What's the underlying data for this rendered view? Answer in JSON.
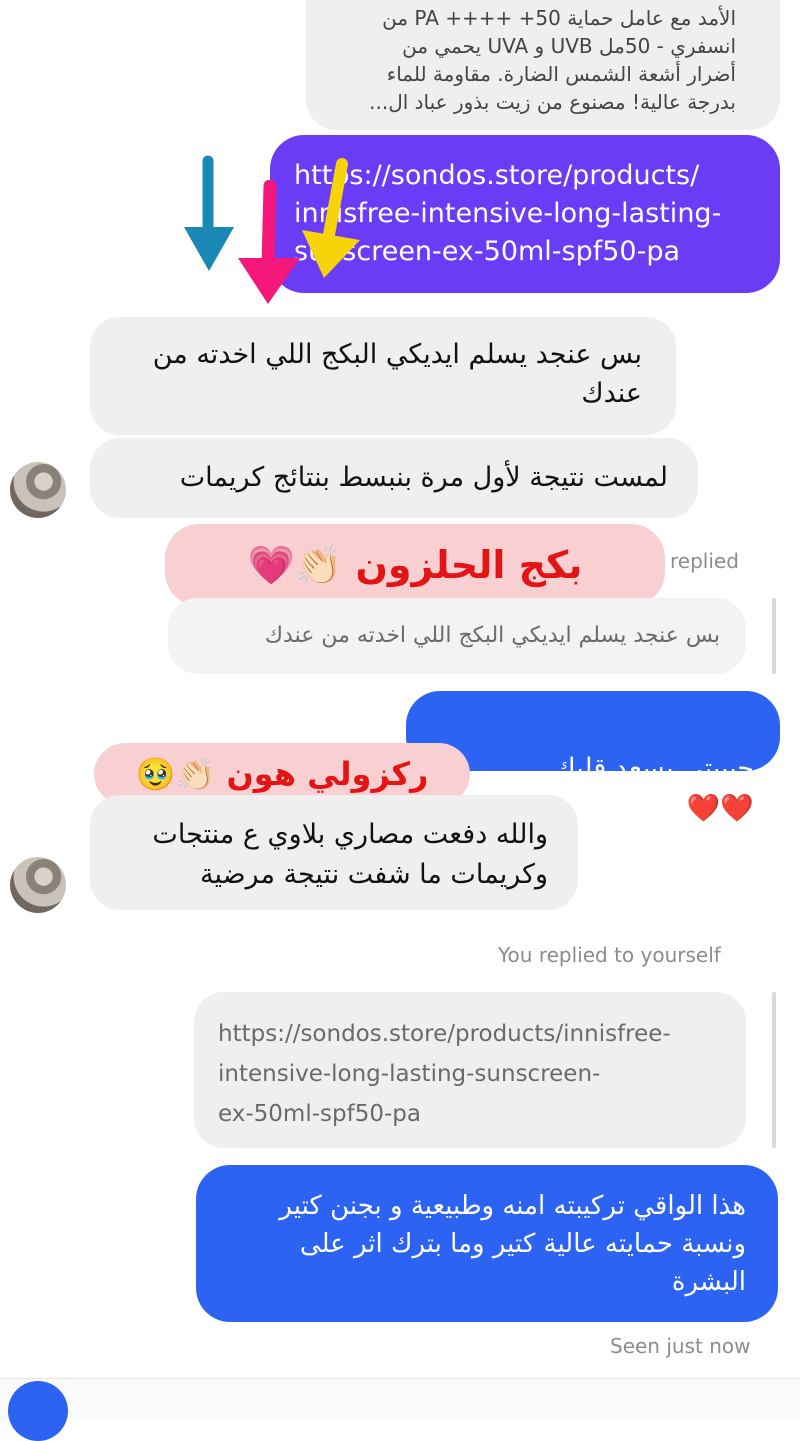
{
  "messages": {
    "top_incoming_text": "الأمد مع عامل حماية 50+ ++++ PA من\nانسفري - 50مل UVB و UVA يحمي من\nأضرار أشعة الشمس الضارة. مقاومة للماء\nبدرجة عالية! مصنوع من زيت بذور عباد ال...",
    "link_outgoing": "https://sondos.store/products/\ninnisfree-intensive-long-lasting-\nsunscreen-ex-50ml-spf50-pa",
    "incoming_1": "بس عنجد يسلم ايديكي البكج اللي اخدته من\nعندك",
    "incoming_2": "لمست نتيجة لأول مرة بنبسط بنتائج كريمات",
    "replied_label": "replied",
    "quoted_reply": "بس عنجد يسلم ايديكي البكج اللي اخدته من عندك",
    "outgoing_love": "حبيبتي يسعد قلبك",
    "outgoing_love_emojis": "❤️❤️",
    "incoming_3": "والله دفعت مصاري بلاوي ع منتجات\nوكريمات ما شفت نتيجة مرضية",
    "replied_yourself_label": "You replied to yourself",
    "quoted_link": "https://sondos.store/products/innisfree-\nintensive-long-lasting-sunscreen-\nex-50ml-spf50-pa",
    "outgoing_final": "هذا الواقي تركيبته امنه وطبيعية و بجنن كتير\nونسبة حمايته عالية كتير وما بترك اثر على\nالبشرة",
    "seen_status": "Seen just now"
  },
  "stickers": {
    "snail_package": "بكج الحلزون",
    "snail_package_emojis": "👏🏻💗",
    "focus_here": "ركزولي هون",
    "focus_here_emojis": "👏🏻🥹"
  },
  "colors": {
    "arrow_blue": "#1a87b4",
    "arrow_pink": "#f5177a",
    "arrow_yellow": "#f7d40a",
    "outgoing_purple": "#6b3cf5",
    "outgoing_blue": "#2c63f3",
    "sticker_red": "#e31414"
  },
  "icons": [
    "sender-avatar-icon",
    "arrow-down-icon",
    "camera-icon"
  ]
}
